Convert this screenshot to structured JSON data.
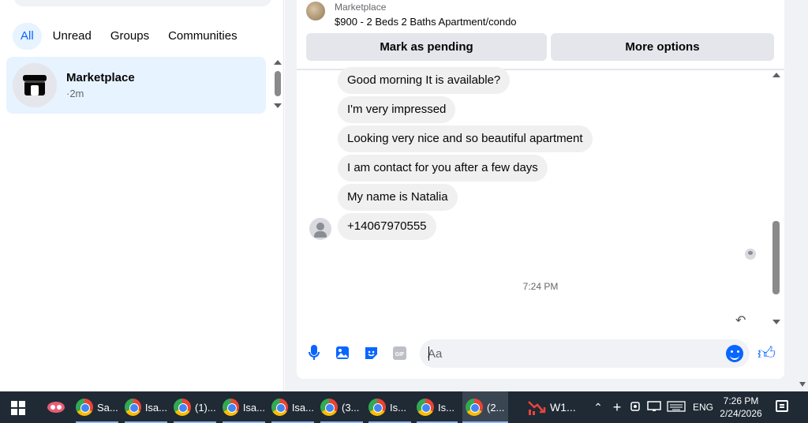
{
  "sidebar": {
    "filters": [
      {
        "label": "All",
        "active": true
      },
      {
        "label": "Unread"
      },
      {
        "label": "Groups"
      },
      {
        "label": "Communities"
      }
    ],
    "conversation": {
      "name": "Marketplace",
      "time": "·2m"
    }
  },
  "chat": {
    "header": {
      "source": "Marketplace",
      "listing": "$900 - 2 Beds 2 Baths Apartment/condo"
    },
    "buttons": {
      "pending": "Mark as pending",
      "more": "More options"
    },
    "messages": [
      "Good morning It is available?",
      "I'm very impressed",
      "Looking very nice and so beautiful apartment",
      "I am contact for you after a few days",
      "My name is Natalia",
      "+14067970555"
    ],
    "timestamp": "7:24 PM",
    "composer": {
      "placeholder": "Aa"
    }
  },
  "taskbar": {
    "apps": [
      {
        "label": "Sa...",
        "icon": "chrome-icon"
      },
      {
        "label": "Isa...",
        "icon": "chrome-icon"
      },
      {
        "label": "(1)...",
        "icon": "chrome-icon"
      },
      {
        "label": "Isa...",
        "icon": "chrome-icon"
      },
      {
        "label": "Isa...",
        "icon": "chrome-icon"
      },
      {
        "label": "(3...",
        "icon": "chrome-icon"
      },
      {
        "label": "Is...",
        "icon": "chrome-icon"
      },
      {
        "label": "Is...",
        "icon": "chrome-icon"
      },
      {
        "label": "(2...",
        "icon": "chrome-icon",
        "active": true
      }
    ],
    "stock": {
      "label": "W1..."
    },
    "language": "ENG",
    "time": "7:26 PM",
    "date": "2/24/2026"
  },
  "colors": {
    "accent": "#0866ff",
    "bubble": "#f0f0f0",
    "taskbar": "#1f2a35"
  }
}
